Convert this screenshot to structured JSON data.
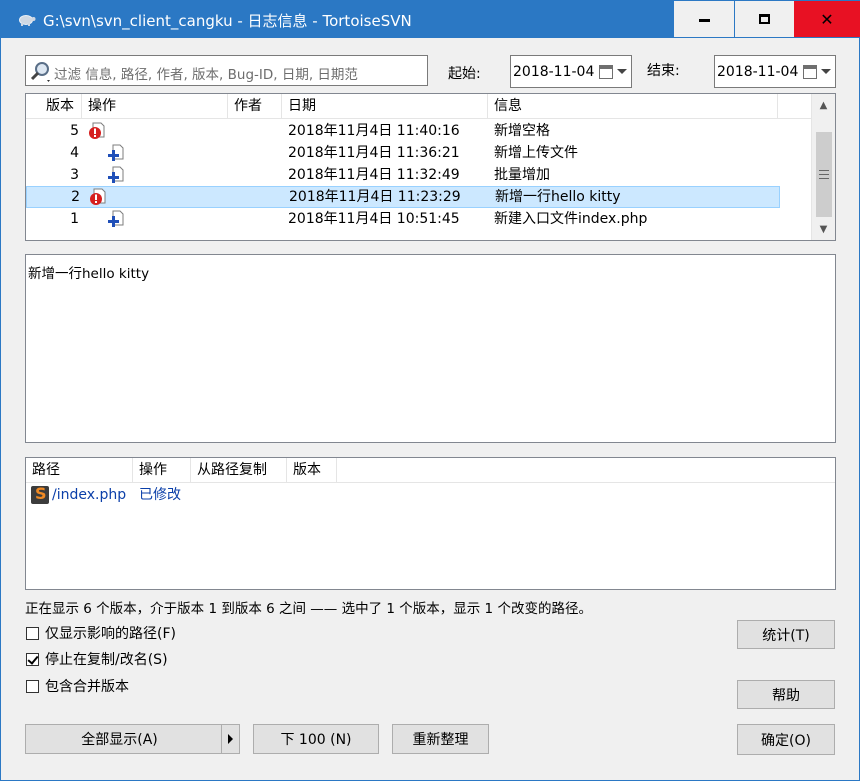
{
  "window": {
    "title": "G:\\svn\\svn_client_cangku - 日志信息 - TortoiseSVN",
    "controls": {
      "minimize": "minimize",
      "maximize": "maximize",
      "close": "✕"
    }
  },
  "filter": {
    "placeholder": "过滤 信息, 路径, 作者, 版本, Bug-ID, 日期, 日期范",
    "from_label": "起始:",
    "from_value": "2018-11-04",
    "to_label": "结束:",
    "to_value": "2018-11-04"
  },
  "log": {
    "columns": [
      "版本",
      "操作",
      "作者",
      "日期",
      "信息"
    ],
    "rows": [
      {
        "rev": "5",
        "action": "modified",
        "author": "",
        "date": "2018年11月4日 11:40:16",
        "message": "新增空格"
      },
      {
        "rev": "4",
        "action": "added",
        "author": "",
        "date": "2018年11月4日 11:36:21",
        "message": "新增上传文件"
      },
      {
        "rev": "3",
        "action": "added",
        "author": "",
        "date": "2018年11月4日 11:32:49",
        "message": "批量增加"
      },
      {
        "rev": "2",
        "action": "modified",
        "author": "",
        "date": "2018年11月4日 11:23:29",
        "message": "新增一行hello kitty",
        "selected": true
      },
      {
        "rev": "1",
        "action": "added",
        "author": "",
        "date": "2018年11月4日 10:51:45",
        "message": "新建入口文件index.php"
      }
    ]
  },
  "message_text": "新增一行hello kitty",
  "paths": {
    "columns": [
      "路径",
      "操作",
      "从路径复制",
      "版本"
    ],
    "rows": [
      {
        "path": "/index.php",
        "action": "已修改",
        "copy_from": "",
        "rev": ""
      }
    ]
  },
  "status_text": "正在显示 6 个版本，介于版本 1 到版本 6 之间 —— 选中了 1 个版本，显示 1 个改变的路径。",
  "options": [
    {
      "label": "仅显示影响的路径(F)",
      "checked": false
    },
    {
      "label": "停止在复制/改名(S)",
      "checked": true
    },
    {
      "label": "包含合并版本",
      "checked": false
    }
  ],
  "buttons": {
    "show_all": "全部显示(A)",
    "next_100": "下 100 (N)",
    "refresh": "重新整理",
    "statistics": "统计(T)",
    "help": "帮助",
    "ok": "确定(O)"
  },
  "colors": {
    "titlebar": "#2b78c4",
    "close_hover": "#e81123",
    "selection": "#cce8ff",
    "link_text": "#0b3fa9"
  }
}
